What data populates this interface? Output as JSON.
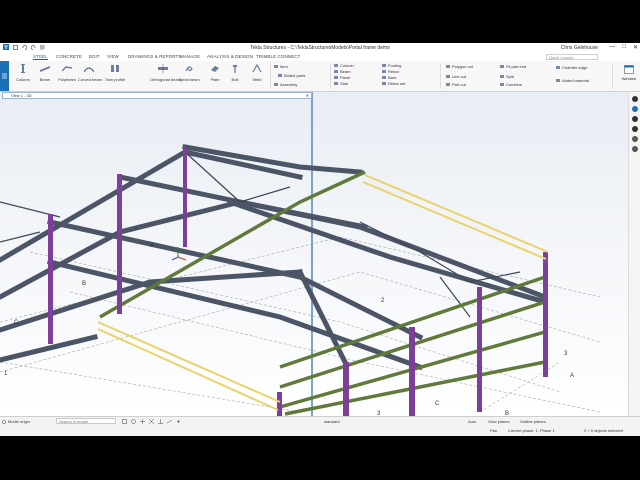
{
  "window": {
    "title": "Tekla Structures - C:\\TeklaStructuresModels\\Portal frame demo",
    "user": "Chris Gelehouse",
    "minimize": "—",
    "maximize": "□",
    "close": "✕"
  },
  "menu": {
    "tabs": [
      "STEEL",
      "CONCRETE",
      "EDIT",
      "VIEW",
      "DRAWINGS & REPORTS",
      "MANAGE",
      "ANALYSIS & DESIGN",
      "TRIMBLE CONNECT"
    ],
    "active_tab": "STEEL",
    "quick_launch_placeholder": "Quick Launch"
  },
  "ribbon": {
    "large_buttons": [
      "Column",
      "Beam",
      "Polybeam",
      "Curved beam",
      "Twin profile",
      "Orthogonal beam",
      "Spiral beam",
      "Plate",
      "Bolt",
      "Weld"
    ],
    "part_group": [
      "Item",
      "Bolted parts",
      "Assembly"
    ],
    "concrete_group": [
      "Column",
      "Beam",
      "Panel",
      "Slab"
    ],
    "footing_group": [
      "Footing",
      "Rebar",
      "Bars",
      "Rebar set"
    ],
    "cut_group": [
      "Polygon cut",
      "Line cut",
      "Part cut"
    ],
    "fit_group": [
      "Fit part end",
      "Split",
      "Combine"
    ],
    "edge_group": [
      "Chamfer edge",
      "Added material"
    ],
    "window_label": "Window"
  },
  "viewport": {
    "view_title": "View 1 - 3D",
    "grid_labels": [
      "A",
      "B",
      "C",
      "A",
      "B",
      "C",
      "2",
      "3",
      "3",
      "1"
    ]
  },
  "statusbar": {
    "snap_label": "Model origin",
    "search_placeholder": "Search in model",
    "work_plane_label": "standard",
    "auto_label": "Auto",
    "view_planes_label": "View planes",
    "outline_label": "Outline planes",
    "pan_label": "Pan",
    "phase_label": "Current phase: 1, Phase 1",
    "selection_label": "2 + 0 objects selected"
  },
  "colors": {
    "accent": "#1b6fb5",
    "steel_member": "#4b5566",
    "column_member": "#7e3f9a",
    "selected_member": "#e9d36b",
    "bracing_member": "#5f7a3a"
  }
}
